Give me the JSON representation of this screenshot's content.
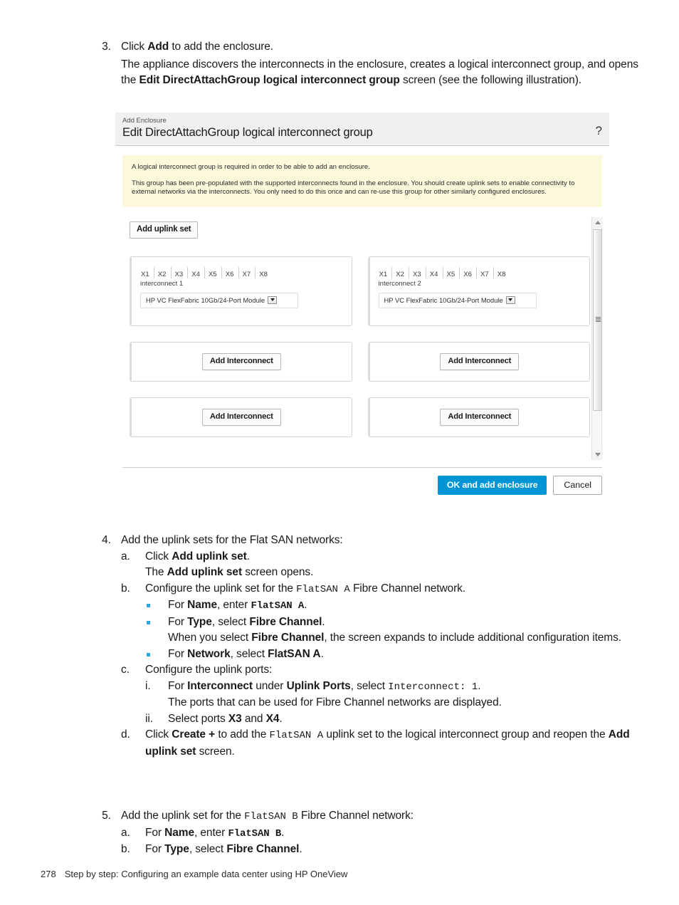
{
  "page": {
    "number": "278",
    "footer_title": "Step by step: Configuring an example data center using HP OneView"
  },
  "step3": {
    "number": "3.",
    "line1_pre": "Click ",
    "line1_bold": "Add",
    "line1_post": " to add the enclosure.",
    "line2_pre": "The appliance discovers the interconnects in the enclosure, creates a logical interconnect group, and opens the ",
    "line2_bold": "Edit DirectAttachGroup logical interconnect group",
    "line2_post": " screen (see the following illustration)."
  },
  "screenshot": {
    "eyebrow": "Add Enclosure",
    "title": "Edit DirectAttachGroup logical interconnect group",
    "help_icon": "?",
    "notice": {
      "paragraph1": "A logical interconnect group is required in order to be able to add an enclosure.",
      "paragraph2": "This group has been pre-populated with the supported interconnects found in the enclosure. You should create uplink sets to enable connectivity to external networks via the interconnects. You only need to do this once and can re-use this group for other similarly configured enclosures."
    },
    "add_uplink_set_label": "Add uplink set",
    "ports": [
      "X1",
      "X2",
      "X3",
      "X4",
      "X5",
      "X6",
      "X7",
      "X8"
    ],
    "interconnects": [
      {
        "name": "interconnect 1",
        "module": "HP VC FlexFabric 10Gb/24-Port Module"
      },
      {
        "name": "interconnect 2",
        "module": "HP VC FlexFabric 10Gb/24-Port Module"
      }
    ],
    "add_interconnect_label": "Add Interconnect",
    "ok_button_label": "OK and add enclosure",
    "cancel_button_label": "Cancel",
    "accent_color": "#0096d6",
    "notice_background": "#fbf8dc",
    "header_background": "#f0f0ef"
  },
  "step4": {
    "number": "4.",
    "intro": "Add the uplink sets for the Flat SAN networks:",
    "a": {
      "marker": "a.",
      "line1_pre": "Click ",
      "line1_bold": "Add uplink set",
      "line1_post": ".",
      "line2_pre": "The ",
      "line2_bold": "Add uplink set",
      "line2_post": " screen opens."
    },
    "b": {
      "marker": "b.",
      "line_pre": "Configure the uplink set for the ",
      "line_mono": "FlatSAN A",
      "line_post": " Fibre Channel network.",
      "bullets": [
        {
          "pre": "For ",
          "bold": "Name",
          "mid": ", enter ",
          "mono": "FlatSAN A",
          "post": "."
        },
        {
          "pre": "For ",
          "bold": "Type",
          "mid": ", select ",
          "bold2": "Fibre Channel",
          "post": ".",
          "sub_pre": "When you select ",
          "sub_bold": "Fibre Channel",
          "sub_post": ", the screen expands to include additional configuration items."
        },
        {
          "pre": "For ",
          "bold": "Network",
          "mid": ", select ",
          "bold2": "FlatSAN A",
          "post": "."
        }
      ]
    },
    "c": {
      "marker": "c.",
      "intro": "Configure the uplink ports:",
      "i": {
        "marker": "i.",
        "line_pre": "For ",
        "line_bold1": "Interconnect",
        "line_mid": " under ",
        "line_bold2": "Uplink Ports",
        "line_mid2": ", select ",
        "line_mono": "Interconnect: 1",
        "line_post": ".",
        "note": "The ports that can be used for Fibre Channel networks are displayed."
      },
      "ii": {
        "marker": "ii.",
        "line_pre": "Select ports ",
        "line_bold1": "X3",
        "line_mid": " and ",
        "line_bold2": "X4",
        "line_post": "."
      }
    },
    "d": {
      "marker": "d.",
      "line_pre": "Click ",
      "line_bold": "Create +",
      "line_mid": " to add the ",
      "line_mono": "FlatSAN A",
      "line_mid2": " uplink set to the logical interconnect group and reopen the ",
      "line_bold2": "Add uplink set",
      "line_post": " screen."
    }
  },
  "step5": {
    "number": "5.",
    "intro_pre": "Add the uplink set for the ",
    "intro_mono": "FlatSAN B",
    "intro_post": " Fibre Channel network:",
    "a": {
      "marker": "a.",
      "pre": "For ",
      "bold": "Name",
      "mid": ", enter ",
      "mono": "FlatSAN B",
      "post": "."
    },
    "b": {
      "marker": "b.",
      "pre": "For ",
      "bold": "Type",
      "mid": ", select ",
      "bold2": "Fibre Channel",
      "post": "."
    }
  }
}
